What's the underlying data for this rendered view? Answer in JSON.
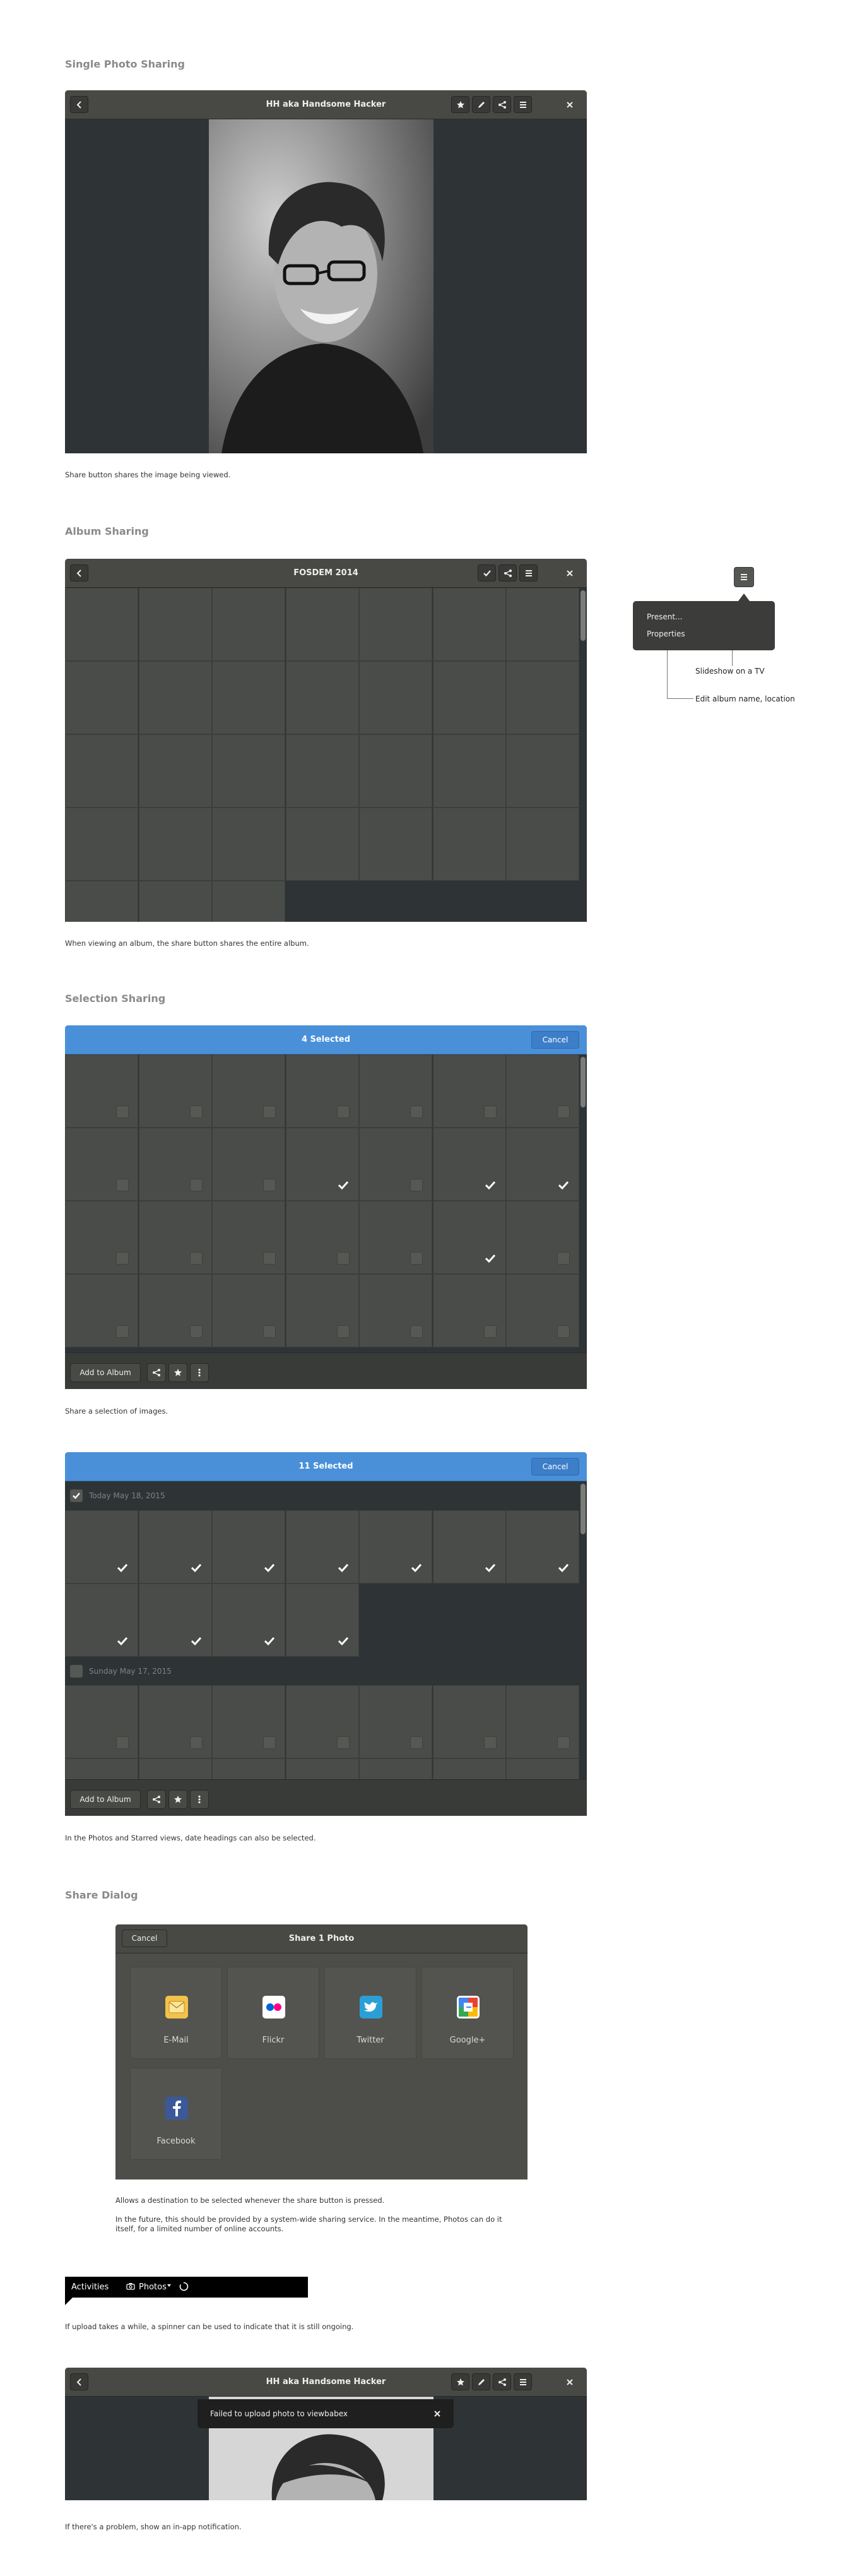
{
  "sections": {
    "single": "Single Photo Sharing",
    "album": "Album Sharing",
    "selection": "Selection Sharing",
    "dialog": "Share Dialog"
  },
  "captions": {
    "single": "Share button shares the image being viewed.",
    "album": "When viewing an album, the share button shares the entire album.",
    "selection1": "Share a selection of images.",
    "selection2": "In the Photos and Starred views, date headings can also be selected.",
    "dialog1": "Allows a destination to be selected whenever the share button is pressed.",
    "dialog2": "In the future, this should be provided by a system-wide sharing service. In the meantime, Photos can do it itself, for a limited number of online accounts.",
    "spinner": "If upload takes a while, a spinner can be used to indicate that it is still ongoing.",
    "error": "If there's a problem, show an in-app notification."
  },
  "photo_window": {
    "title": "HH aka Handsome Hacker"
  },
  "album_window": {
    "title": "FOSDEM 2014"
  },
  "popover": {
    "items": [
      "Present...",
      "Properties"
    ],
    "annotations": [
      "Slideshow on a TV",
      "Edit album name, location"
    ]
  },
  "selection1": {
    "title": "4 Selected",
    "cancel": "Cancel",
    "add_to_album": "Add to Album"
  },
  "selection2": {
    "title": "11 Selected",
    "cancel": "Cancel",
    "add_to_album": "Add to Album",
    "date1": "Today May 18, 2015",
    "date2": "Sunday May 17, 2015"
  },
  "share_dialog": {
    "cancel": "Cancel",
    "title": "Share 1 Photo",
    "services": [
      {
        "label": "E-Mail",
        "icon": "email-icon",
        "color": "#f3c24a"
      },
      {
        "label": "Flickr",
        "icon": "flickr-icon",
        "color": "#ffffff"
      },
      {
        "label": "Twitter",
        "icon": "twitter-icon",
        "color": "#2a9fd6"
      },
      {
        "label": "Google+",
        "icon": "google-plus-icon",
        "color": "#ffffff"
      },
      {
        "label": "Facebook",
        "icon": "facebook-icon",
        "color": "#3b5998"
      }
    ]
  },
  "topbar": {
    "activities": "Activities",
    "app": "Photos"
  },
  "notification": {
    "text": "Failed to upload photo to viewbabex"
  },
  "colors": {
    "selection_blue": "#4a90d9",
    "headerbar": "#484945",
    "content": "#2e3436"
  }
}
